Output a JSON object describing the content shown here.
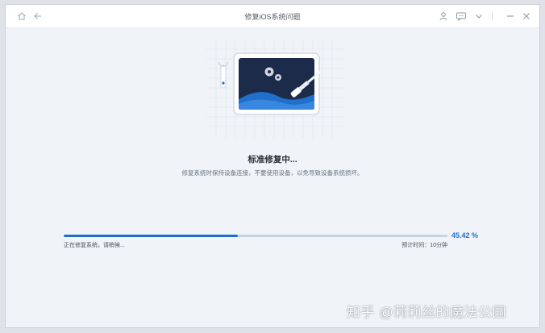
{
  "window": {
    "title": "修复iOS系统问题"
  },
  "titlebar": {
    "home_icon": "home-icon",
    "back_icon": "arrow-left-icon",
    "user_icon": "user-icon",
    "feedback_icon": "message-icon",
    "menu_icon": "chevron-down-icon",
    "minimize_icon": "minimize-icon",
    "close_icon": "close-icon"
  },
  "status": {
    "title": "标准修复中...",
    "subtitle": "修复系统时保持设备连接，不要使用设备，以免导致设备系统损坏。"
  },
  "progress": {
    "value": 45.42,
    "percent_label": "45.42 %",
    "left_label": "正在修复系统，请稍候...",
    "right_label": "预计时间：10分钟"
  },
  "watermark": {
    "text": "知乎 @莉莉丝的魔法公园"
  },
  "colors": {
    "accent": "#1f6fcb",
    "background": "#f0f4f8",
    "track": "#c9d3de"
  }
}
